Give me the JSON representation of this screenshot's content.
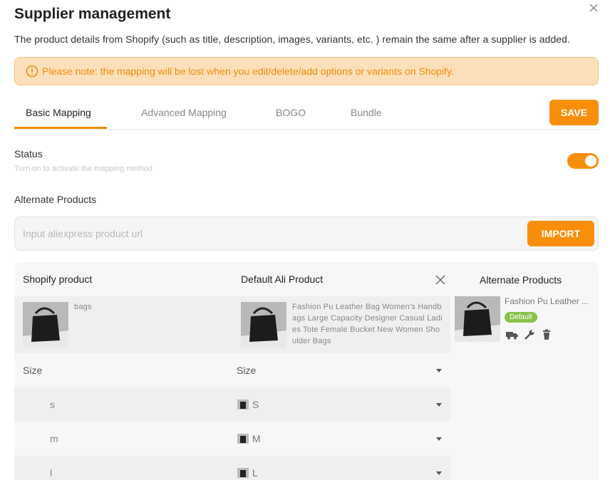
{
  "dialog": {
    "title": "Supplier management",
    "subtitle": "The product details from Shopify (such as title, description, images, variants, etc. ) remain the same after a supplier is added.",
    "notice": "Please note: the mapping will be lost when you edit/delete/add options or variants on Shopify."
  },
  "tabs": [
    {
      "label": "Basic Mapping",
      "active": true
    },
    {
      "label": "Advanced Mapping"
    },
    {
      "label": "BOGO"
    },
    {
      "label": "Bundle"
    }
  ],
  "toolbar": {
    "save_label": "SAVE"
  },
  "status": {
    "label": "Status",
    "hint": "Turn on to activate the mapping method",
    "enabled": true
  },
  "alternate": {
    "section_label": "Alternate Products",
    "url_placeholder": "Input aliexpress product url",
    "import_label": "IMPORT"
  },
  "mapping": {
    "headers": {
      "shopify": "Shopify product",
      "default_ali": "Default Ali Product",
      "alternate": "Alternate Products"
    },
    "shopify_product": {
      "name": "bags"
    },
    "ali_product": {
      "name": "Fashion Pu Leather Bag Women's Handbags Large Capacity Designer Casual Ladies Tote Female Bucket New Women Shoulder Bags"
    },
    "alternate_product": {
      "name": "Fashion Pu Leather ...",
      "badge": "Default"
    },
    "option_name": "Size",
    "ali_option_name": "Size",
    "rows": [
      {
        "shopify": "s",
        "ali": "S"
      },
      {
        "shopify": "m",
        "ali": "M"
      },
      {
        "shopify": "l",
        "ali": "L"
      }
    ]
  },
  "colors": {
    "accent": "#f98e0b",
    "notice_bg": "#fde0bb",
    "badge": "#87c34b"
  },
  "icons": [
    "close-icon",
    "warning-icon",
    "truck-icon",
    "wrench-icon",
    "trash-icon"
  ]
}
